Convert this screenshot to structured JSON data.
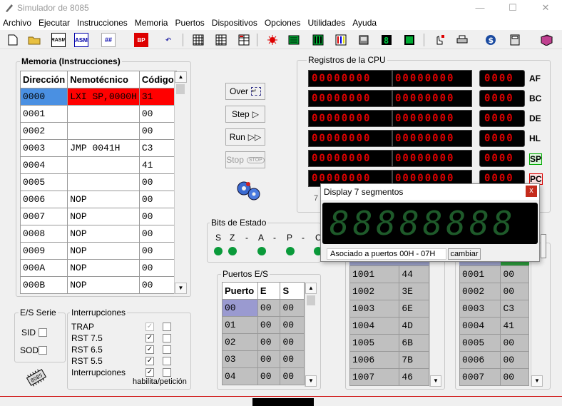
{
  "window": {
    "title": "Simulador de 8085",
    "minimize": "—",
    "maximize": "☐",
    "close": "✕"
  },
  "menu": [
    "Archivo",
    "Ejecutar",
    "Instrucciones",
    "Memoria",
    "Puertos",
    "Dispositivos",
    "Opciones",
    "Utilidades",
    "Ayuda"
  ],
  "toolbar": {
    "asm_label": "ASM",
    "hash_label": "##",
    "bp_label": "BP",
    "rasm_label": "RASM"
  },
  "memory": {
    "title": "Memoria (Instrucciones)",
    "headers": [
      "Dirección",
      "Nemotécnico",
      "Código"
    ],
    "rows": [
      [
        "0000",
        "LXI SP,0000H",
        "31"
      ],
      [
        "0001",
        "",
        "00"
      ],
      [
        "0002",
        "",
        "00"
      ],
      [
        "0003",
        "JMP 0041H",
        "C3"
      ],
      [
        "0004",
        "",
        "41"
      ],
      [
        "0005",
        "",
        "00"
      ],
      [
        "0006",
        "NOP",
        "00"
      ],
      [
        "0007",
        "NOP",
        "00"
      ],
      [
        "0008",
        "NOP",
        "00"
      ],
      [
        "0009",
        "NOP",
        "00"
      ],
      [
        "000A",
        "NOP",
        "00"
      ],
      [
        "000B",
        "NOP",
        "00"
      ]
    ]
  },
  "controls": {
    "over": "Over",
    "step": "Step",
    "run": "Run",
    "stop": "Stop"
  },
  "registers": {
    "title": "Registros de la CPU",
    "bin": "00000000",
    "hex": "0000",
    "names": [
      "AF",
      "BC",
      "DE",
      "HL",
      "SP",
      "PC"
    ],
    "partial": "7"
  },
  "status": {
    "title": "Bits de Estado",
    "flags": [
      "S",
      "Z",
      "-",
      "A",
      "-",
      "P",
      "-",
      "C"
    ]
  },
  "serial": {
    "title": "E/S Serie",
    "sid": "SID",
    "sod": "SOD"
  },
  "interrupts": {
    "title": "Interrupciones",
    "items": [
      "TRAP",
      "RST 7.5",
      "RST 6.5",
      "RST 5.5",
      "Interrupciones"
    ],
    "footer": "habilita/petición"
  },
  "ports": {
    "title": "Puertos E/S",
    "headers": [
      "Puerto",
      "E",
      "S"
    ],
    "rows": [
      [
        "00",
        "00",
        "00"
      ],
      [
        "01",
        "00",
        "00"
      ],
      [
        "02",
        "00",
        "00"
      ],
      [
        "03",
        "00",
        "00"
      ],
      [
        "04",
        "00",
        "00"
      ]
    ]
  },
  "memview1": {
    "rows": [
      [
        "1001",
        "44"
      ],
      [
        "1002",
        "3E"
      ],
      [
        "1003",
        "6E"
      ],
      [
        "1004",
        "4D"
      ],
      [
        "1005",
        "6B"
      ],
      [
        "1006",
        "7B"
      ],
      [
        "1007",
        "46"
      ]
    ]
  },
  "memview2": {
    "rows": [
      [
        "0001",
        "00"
      ],
      [
        "0002",
        "00"
      ],
      [
        "0003",
        "C3"
      ],
      [
        "0004",
        "41"
      ],
      [
        "0005",
        "00"
      ],
      [
        "0006",
        "00"
      ],
      [
        "0007",
        "00"
      ]
    ]
  },
  "display": {
    "title": "Display 7 segmentos",
    "close": "x",
    "digits": "88888888",
    "assoc": "Asociado a puertos 00H - 07H",
    "change": "cambiar"
  },
  "colors": {
    "selected_row": "#4a90e2",
    "highlight": "#ff0000",
    "seg_red": "#dd0000",
    "seg_green": "#1e5a2a",
    "led": "#0a9a3a"
  }
}
